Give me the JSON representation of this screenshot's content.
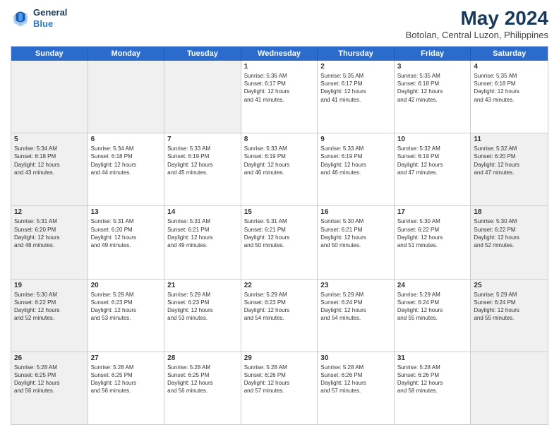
{
  "header": {
    "logo_line1": "General",
    "logo_line2": "Blue",
    "title": "May 2024",
    "subtitle": "Botolan, Central Luzon, Philippines"
  },
  "weekdays": [
    "Sunday",
    "Monday",
    "Tuesday",
    "Wednesday",
    "Thursday",
    "Friday",
    "Saturday"
  ],
  "rows": [
    {
      "cells": [
        {
          "day": "",
          "info": "",
          "shaded": true
        },
        {
          "day": "",
          "info": "",
          "shaded": true
        },
        {
          "day": "",
          "info": "",
          "shaded": true
        },
        {
          "day": "1",
          "info": "Sunrise: 5:36 AM\nSunset: 6:17 PM\nDaylight: 12 hours\nand 41 minutes.",
          "shaded": false
        },
        {
          "day": "2",
          "info": "Sunrise: 5:35 AM\nSunset: 6:17 PM\nDaylight: 12 hours\nand 41 minutes.",
          "shaded": false
        },
        {
          "day": "3",
          "info": "Sunrise: 5:35 AM\nSunset: 6:18 PM\nDaylight: 12 hours\nand 42 minutes.",
          "shaded": false
        },
        {
          "day": "4",
          "info": "Sunrise: 5:35 AM\nSunset: 6:18 PM\nDaylight: 12 hours\nand 43 minutes.",
          "shaded": false
        }
      ]
    },
    {
      "cells": [
        {
          "day": "5",
          "info": "Sunrise: 5:34 AM\nSunset: 6:18 PM\nDaylight: 12 hours\nand 43 minutes.",
          "shaded": true
        },
        {
          "day": "6",
          "info": "Sunrise: 5:34 AM\nSunset: 6:18 PM\nDaylight: 12 hours\nand 44 minutes.",
          "shaded": false
        },
        {
          "day": "7",
          "info": "Sunrise: 5:33 AM\nSunset: 6:19 PM\nDaylight: 12 hours\nand 45 minutes.",
          "shaded": false
        },
        {
          "day": "8",
          "info": "Sunrise: 5:33 AM\nSunset: 6:19 PM\nDaylight: 12 hours\nand 46 minutes.",
          "shaded": false
        },
        {
          "day": "9",
          "info": "Sunrise: 5:33 AM\nSunset: 6:19 PM\nDaylight: 12 hours\nand 46 minutes.",
          "shaded": false
        },
        {
          "day": "10",
          "info": "Sunrise: 5:32 AM\nSunset: 6:19 PM\nDaylight: 12 hours\nand 47 minutes.",
          "shaded": false
        },
        {
          "day": "11",
          "info": "Sunrise: 5:32 AM\nSunset: 6:20 PM\nDaylight: 12 hours\nand 47 minutes.",
          "shaded": true
        }
      ]
    },
    {
      "cells": [
        {
          "day": "12",
          "info": "Sunrise: 5:31 AM\nSunset: 6:20 PM\nDaylight: 12 hours\nand 48 minutes.",
          "shaded": true
        },
        {
          "day": "13",
          "info": "Sunrise: 5:31 AM\nSunset: 6:20 PM\nDaylight: 12 hours\nand 49 minutes.",
          "shaded": false
        },
        {
          "day": "14",
          "info": "Sunrise: 5:31 AM\nSunset: 6:21 PM\nDaylight: 12 hours\nand 49 minutes.",
          "shaded": false
        },
        {
          "day": "15",
          "info": "Sunrise: 5:31 AM\nSunset: 6:21 PM\nDaylight: 12 hours\nand 50 minutes.",
          "shaded": false
        },
        {
          "day": "16",
          "info": "Sunrise: 5:30 AM\nSunset: 6:21 PM\nDaylight: 12 hours\nand 50 minutes.",
          "shaded": false
        },
        {
          "day": "17",
          "info": "Sunrise: 5:30 AM\nSunset: 6:22 PM\nDaylight: 12 hours\nand 51 minutes.",
          "shaded": false
        },
        {
          "day": "18",
          "info": "Sunrise: 5:30 AM\nSunset: 6:22 PM\nDaylight: 12 hours\nand 52 minutes.",
          "shaded": true
        }
      ]
    },
    {
      "cells": [
        {
          "day": "19",
          "info": "Sunrise: 5:30 AM\nSunset: 6:22 PM\nDaylight: 12 hours\nand 52 minutes.",
          "shaded": true
        },
        {
          "day": "20",
          "info": "Sunrise: 5:29 AM\nSunset: 6:23 PM\nDaylight: 12 hours\nand 53 minutes.",
          "shaded": false
        },
        {
          "day": "21",
          "info": "Sunrise: 5:29 AM\nSunset: 6:23 PM\nDaylight: 12 hours\nand 53 minutes.",
          "shaded": false
        },
        {
          "day": "22",
          "info": "Sunrise: 5:29 AM\nSunset: 6:23 PM\nDaylight: 12 hours\nand 54 minutes.",
          "shaded": false
        },
        {
          "day": "23",
          "info": "Sunrise: 5:29 AM\nSunset: 6:24 PM\nDaylight: 12 hours\nand 54 minutes.",
          "shaded": false
        },
        {
          "day": "24",
          "info": "Sunrise: 5:29 AM\nSunset: 6:24 PM\nDaylight: 12 hours\nand 55 minutes.",
          "shaded": false
        },
        {
          "day": "25",
          "info": "Sunrise: 5:29 AM\nSunset: 6:24 PM\nDaylight: 12 hours\nand 55 minutes.",
          "shaded": true
        }
      ]
    },
    {
      "cells": [
        {
          "day": "26",
          "info": "Sunrise: 5:28 AM\nSunset: 6:25 PM\nDaylight: 12 hours\nand 56 minutes.",
          "shaded": true
        },
        {
          "day": "27",
          "info": "Sunrise: 5:28 AM\nSunset: 6:25 PM\nDaylight: 12 hours\nand 56 minutes.",
          "shaded": false
        },
        {
          "day": "28",
          "info": "Sunrise: 5:28 AM\nSunset: 6:25 PM\nDaylight: 12 hours\nand 56 minutes.",
          "shaded": false
        },
        {
          "day": "29",
          "info": "Sunrise: 5:28 AM\nSunset: 6:26 PM\nDaylight: 12 hours\nand 57 minutes.",
          "shaded": false
        },
        {
          "day": "30",
          "info": "Sunrise: 5:28 AM\nSunset: 6:26 PM\nDaylight: 12 hours\nand 57 minutes.",
          "shaded": false
        },
        {
          "day": "31",
          "info": "Sunrise: 5:28 AM\nSunset: 6:26 PM\nDaylight: 12 hours\nand 58 minutes.",
          "shaded": false
        },
        {
          "day": "",
          "info": "",
          "shaded": true
        }
      ]
    }
  ]
}
